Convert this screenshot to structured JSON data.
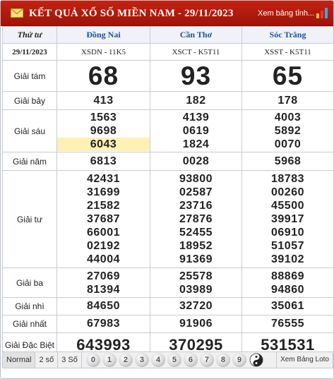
{
  "header": {
    "title": "KẾT QUẢ XỔ SỐ MIỀN NAM - 29/11/2023",
    "view_more": "Xem bảng tỉnh...",
    "mail_icon": "envelope-icon",
    "chart_icon": "bar-chart-icon"
  },
  "columns": {
    "day": "Thứ tư",
    "date": "29/11/2023",
    "provinces": [
      {
        "name": "Đồng Nai",
        "code": "XSDN - 11K5"
      },
      {
        "name": "Cần Thơ",
        "code": "XSCT - K5T11"
      },
      {
        "name": "Sóc Trăng",
        "code": "XSST - K5T11"
      }
    ]
  },
  "prizes": {
    "g8": {
      "label": "Giải tám",
      "values": [
        "68",
        "93",
        "65"
      ]
    },
    "g7": {
      "label": "Giải bảy",
      "values": [
        "413",
        "182",
        "178"
      ]
    },
    "g6": {
      "label": "Giải sáu",
      "values": [
        [
          "1563",
          "9698",
          "6043"
        ],
        [
          "4139",
          "0619",
          "1824"
        ],
        [
          "4003",
          "5892",
          "0070"
        ]
      ]
    },
    "g5": {
      "label": "Giải năm",
      "values": [
        "6813",
        "0028",
        "5968"
      ]
    },
    "g4": {
      "label": "Giải tư",
      "values": [
        [
          "42431",
          "31699",
          "21582",
          "37687",
          "66001",
          "02192",
          "44004"
        ],
        [
          "93800",
          "02587",
          "23716",
          "27876",
          "52455",
          "18952",
          "91369"
        ],
        [
          "18783",
          "00260",
          "45500",
          "39917",
          "06910",
          "51057",
          "39102"
        ]
      ]
    },
    "g3": {
      "label": "Giải ba",
      "values": [
        [
          "27069",
          "81394"
        ],
        [
          "25578",
          "03989"
        ],
        [
          "88869",
          "94860"
        ]
      ]
    },
    "g2": {
      "label": "Giải nhì",
      "values": [
        "84650",
        "32720",
        "35061"
      ]
    },
    "g1": {
      "label": "Giải nhất",
      "values": [
        "67983",
        "91906",
        "76555"
      ]
    },
    "gdb": {
      "label": "Giải Đặc Biệt",
      "values": [
        "643993",
        "370295",
        "531531"
      ]
    }
  },
  "highlight_color": "#fff0b3",
  "accent_color": "#a2130b",
  "footer": {
    "tabs": [
      "Normal",
      "2 số",
      "3 Số"
    ],
    "digits": [
      "0",
      "1",
      "2",
      "3",
      "4",
      "5",
      "6",
      "7",
      "8",
      "9"
    ],
    "loto_link": "Xem Bảng Loto",
    "yinyang_icon": "yin-yang-icon"
  }
}
